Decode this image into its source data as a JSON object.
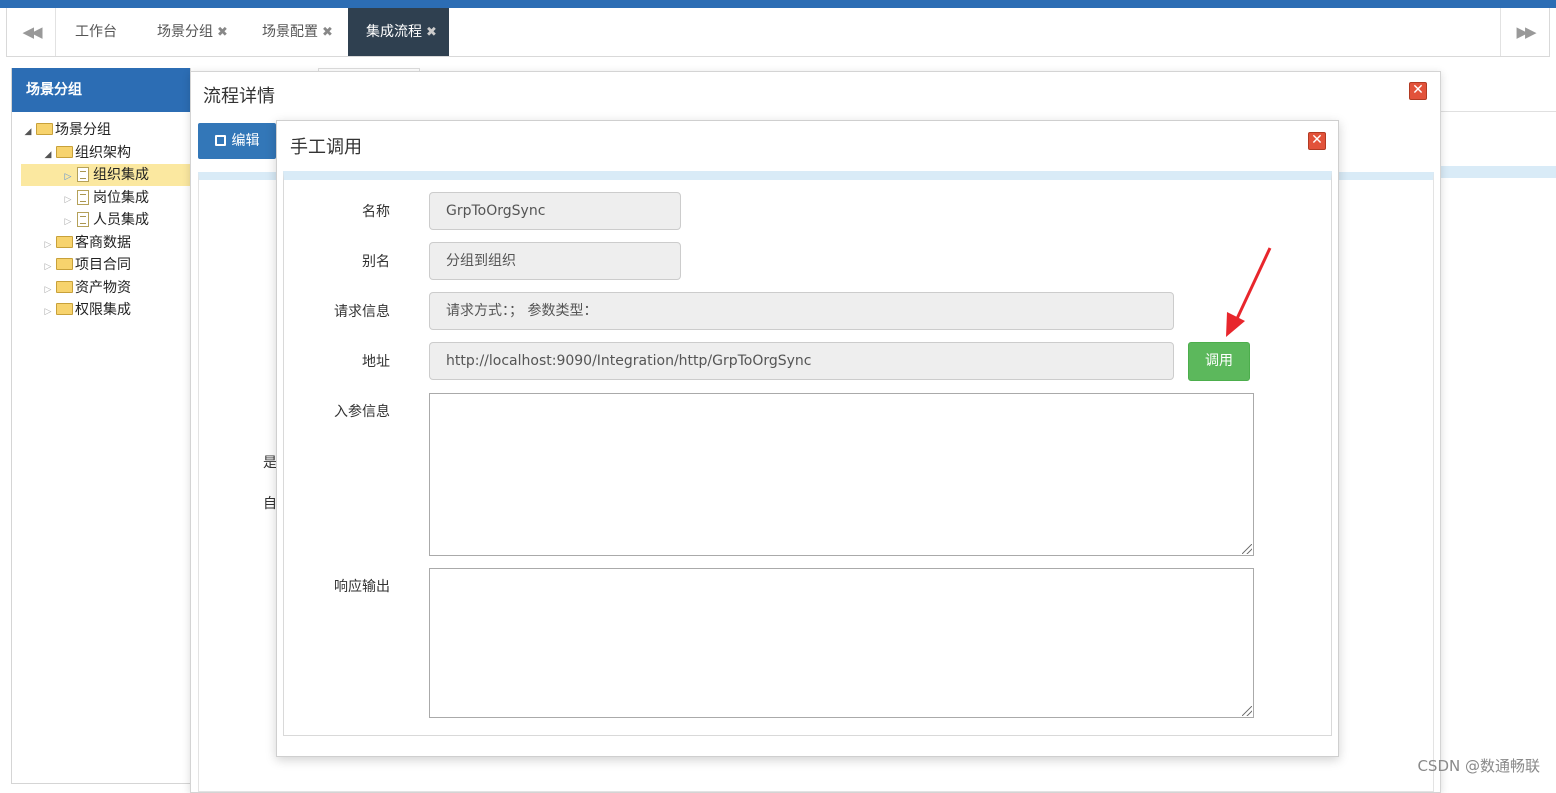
{
  "tabs": {
    "prev_icon": "double-left-icon",
    "next_icon": "double-right-icon",
    "items": [
      {
        "label": "工作台"
      },
      {
        "label": "场景分组",
        "close": "✖"
      },
      {
        "label": "场景配置",
        "close": "✖"
      },
      {
        "label": "集成流程",
        "close": "✖",
        "active": true
      }
    ]
  },
  "sidebar": {
    "header": "场景分组",
    "tree": [
      {
        "label": "场景分组",
        "toggle": "◢"
      },
      {
        "label": "组织架构",
        "toggle": "◢"
      },
      {
        "label": "组织集成",
        "toggle": "▷",
        "selected": true
      },
      {
        "label": "岗位集成",
        "toggle": "▷"
      },
      {
        "label": "人员集成",
        "toggle": "▷"
      },
      {
        "label": "客商数据",
        "toggle": "▷"
      },
      {
        "label": "项目合同",
        "toggle": "▷"
      },
      {
        "label": "资产物资",
        "toggle": "▷"
      },
      {
        "label": "权限集成",
        "toggle": "▷"
      }
    ]
  },
  "background": {
    "label_1": "是",
    "label_2": "自"
  },
  "dialog_detail": {
    "title": "流程详情",
    "edit_label": "编辑",
    "close": "✕"
  },
  "dialog_manual": {
    "title": "手工调用",
    "close": "✕",
    "fields": {
      "name_label": "名称",
      "name_value": "GrpToOrgSync",
      "alias_label": "别名",
      "alias_value": "分组到组织",
      "request_label": "请求信息",
      "request_value": "请求方式：； 参数类型：",
      "url_label": "地址",
      "url_value": "http://localhost:9090/Integration/http/GrpToOrgSync",
      "input_label": "入参信息",
      "input_value": "",
      "output_label": "响应输出",
      "output_value": ""
    },
    "call_label": "调用"
  },
  "colors": {
    "brand_blue": "#2c6db4",
    "active_tab": "#2f4050",
    "call_green": "#5cb85c",
    "close_red": "#e2523a",
    "annotation_arrow": "#e8262c"
  },
  "watermark": "CSDN @数通畅联"
}
